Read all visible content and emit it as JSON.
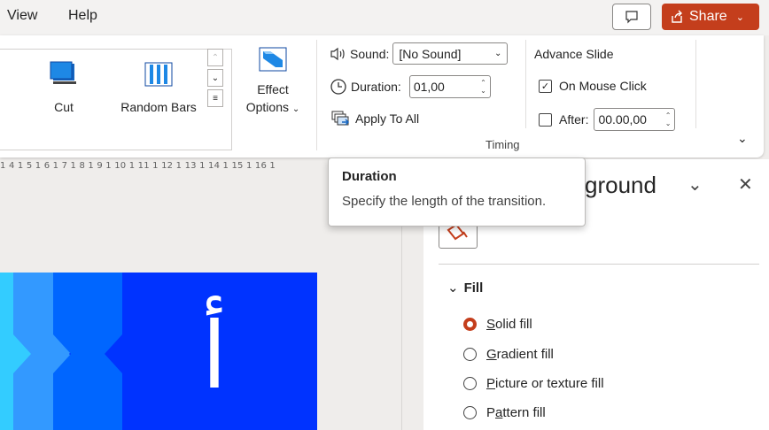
{
  "menu": {
    "items": [
      "View",
      "Help"
    ],
    "share_label": "Share"
  },
  "ribbon": {
    "transitions": [
      {
        "label": "Cut"
      },
      {
        "label": "Random Bars"
      }
    ],
    "effect_options": {
      "line1": "Effect",
      "line2": "Options"
    },
    "sound": {
      "label": "Sound:",
      "value": "[No Sound]"
    },
    "duration": {
      "label": "Duration:",
      "value": "01,00"
    },
    "apply_all_label": "Apply To All",
    "advance": {
      "title": "Advance Slide",
      "on_click_label": "On Mouse Click",
      "on_click_checked": true,
      "after_label": "After:",
      "after_checked": false,
      "after_value": "00.00,00"
    },
    "group_label": "Timing"
  },
  "ruler": {
    "text": "1 4 1 5 1 6 1 7 1 8 1 9 1 10 1 11 1 12 1 13 1 14 1 15 1 16 1"
  },
  "slide": {
    "glyph": "أ",
    "bg_color": "#0033ff",
    "stripe_colors": [
      "#33ccff",
      "#3399ff",
      "#0066ff"
    ]
  },
  "pane": {
    "title_visible": "ground",
    "section": "Fill",
    "options": [
      {
        "pre": "",
        "ul": "S",
        "post": "olid fill",
        "selected": true
      },
      {
        "pre": "",
        "ul": "G",
        "post": "radient fill",
        "selected": false
      },
      {
        "pre": "",
        "ul": "P",
        "post": "icture or texture fill",
        "selected": false
      },
      {
        "pre": "P",
        "ul": "a",
        "post": "ttern fill",
        "selected": false
      }
    ]
  },
  "tooltip": {
    "title": "Duration",
    "body": "Specify the length of the transition."
  },
  "colors": {
    "accent": "#c43e1c"
  }
}
